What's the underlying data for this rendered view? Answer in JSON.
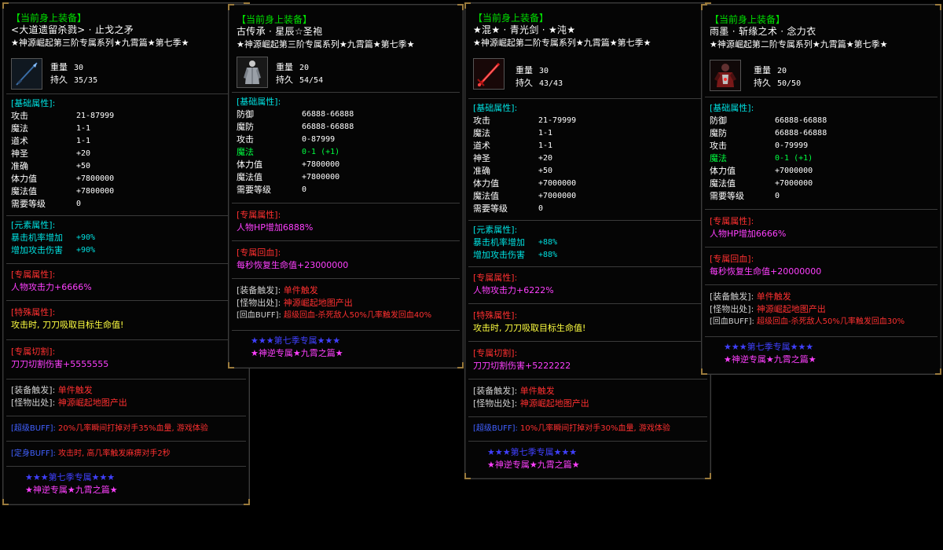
{
  "cards": [
    {
      "header": "【当前身上装备】",
      "name": "<大道遗留杀戮> · 止戈之矛",
      "series": "★神源崛起第三阶专属系列★九霄篇★第七季★",
      "icon": "spear-icon",
      "weight_label": "重量",
      "weight": "30",
      "durability_label": "持久",
      "durability": "35/35",
      "base_title": "[基础属性]:",
      "base": [
        {
          "k": "攻击",
          "v": "21-87999"
        },
        {
          "k": "魔法",
          "v": "1-1"
        },
        {
          "k": "道术",
          "v": "1-1"
        },
        {
          "k": "神圣",
          "v": "+20"
        },
        {
          "k": "准确",
          "v": "+50"
        },
        {
          "k": "体力值",
          "v": "+7800000"
        },
        {
          "k": "魔法值",
          "v": "+7800000"
        },
        {
          "k": "需要等级",
          "v": "0"
        }
      ],
      "element_title": "[元素属性]:",
      "element": [
        {
          "k": "暴击机率增加",
          "v": "+90%"
        },
        {
          "k": "增加攻击伤害",
          "v": "+90%"
        }
      ],
      "exclusive_title": "[专属属性]:",
      "exclusive": "人物攻击力+6666%",
      "special_title": "[特殊属性]:",
      "special": "攻击时, 刀刀吸取目标生命值!",
      "cut_title": "[专属切割]:",
      "cut": "刀刀切割伤害+5555555",
      "trigger_label": "[装备触发]:",
      "trigger": "单件触发",
      "drop_label": "[怪物出处]:",
      "drop": "神源崛起地图产出",
      "buff1_label": "[超级BUFF]:",
      "buff1": "20%几率瞬间打掉对手35%血量, 游戏体验",
      "buff2_label": "[定身BUFF]:",
      "buff2": "攻击时, 高几率触发麻痹对手2秒",
      "footer1": "★★★第七季专属★★★",
      "footer2": "★神逆专属★九霄之篇★"
    },
    {
      "header": "【当前身上装备】",
      "name": "古传承 · 星辰☆圣袍",
      "series": "★神源崛起第三阶专属系列★九霄篇★第七季★",
      "icon": "robe-icon",
      "weight_label": "重量",
      "weight": "20",
      "durability_label": "持久",
      "durability": "54/54",
      "base_title": "[基础属性]:",
      "base": [
        {
          "k": "防御",
          "v": "66888-66888"
        },
        {
          "k": "魔防",
          "v": "66888-66888"
        },
        {
          "k": "攻击",
          "v": "0-87999"
        },
        {
          "k": "魔法",
          "v": "0-1 (+1)",
          "green": true
        },
        {
          "k": "体力值",
          "v": "+7800000"
        },
        {
          "k": "魔法值",
          "v": "+7800000"
        },
        {
          "k": "需要等级",
          "v": "0"
        }
      ],
      "exclusive_title": "[专属属性]:",
      "exclusive": "人物HP增加6888%",
      "regen_title": "[专属回血]:",
      "regen": "每秒恢复生命值+23000000",
      "trigger_label": "[装备触发]:",
      "trigger": "单件触发",
      "drop_label": "[怪物出处]:",
      "drop": "神源崛起地图产出",
      "buff_label": "[回血BUFF]:",
      "buff": "超级回血-杀死敌人50%几率触发回血40%",
      "footer1": "★★★第七季专属★★★",
      "footer2": "★神逆专属★九霄之篇★"
    },
    {
      "header": "【当前身上装备】",
      "name": "★混★ · 青光剑 · ★沌★",
      "series": "★神源崛起第二阶专属系列★九霄篇★第七季★",
      "icon": "sword-icon",
      "weight_label": "重量",
      "weight": "30",
      "durability_label": "持久",
      "durability": "43/43",
      "base_title": "[基础属性]:",
      "base": [
        {
          "k": "攻击",
          "v": "21-79999"
        },
        {
          "k": "魔法",
          "v": "1-1"
        },
        {
          "k": "道术",
          "v": "1-1"
        },
        {
          "k": "神圣",
          "v": "+20"
        },
        {
          "k": "准确",
          "v": "+50"
        },
        {
          "k": "体力值",
          "v": "+7000000"
        },
        {
          "k": "魔法值",
          "v": "+7000000"
        },
        {
          "k": "需要等级",
          "v": "0"
        }
      ],
      "element_title": "[元素属性]:",
      "element": [
        {
          "k": "暴击机率增加",
          "v": "+88%"
        },
        {
          "k": "增加攻击伤害",
          "v": "+88%"
        }
      ],
      "exclusive_title": "[专属属性]:",
      "exclusive": "人物攻击力+6222%",
      "special_title": "[特殊属性]:",
      "special": "攻击时, 刀刀吸取目标生命值!",
      "cut_title": "[专属切割]:",
      "cut": "刀刀切割伤害+5222222",
      "trigger_label": "[装备触发]:",
      "trigger": "单件触发",
      "drop_label": "[怪物出处]:",
      "drop": "神源崛起地图产出",
      "buff1_label": "[超级BUFF]:",
      "buff1": "10%几率瞬间打掉对手30%血量, 游戏体验",
      "footer1": "★★★第七季专属★★★",
      "footer2": "★神逆专属★九霄之篇★"
    },
    {
      "header": "【当前身上装备】",
      "name": "雨墨 · 斩缘之术 · 念力衣",
      "series": "★神源崛起第二阶专属系列★九霄篇★第七季★",
      "icon": "armor-icon",
      "weight_label": "重量",
      "weight": "20",
      "durability_label": "持久",
      "durability": "50/50",
      "base_title": "[基础属性]:",
      "base": [
        {
          "k": "防御",
          "v": "66888-66888"
        },
        {
          "k": "魔防",
          "v": "66888-66888"
        },
        {
          "k": "攻击",
          "v": "0-79999"
        },
        {
          "k": "魔法",
          "v": "0-1 (+1)",
          "green": true
        },
        {
          "k": "体力值",
          "v": "+7000000"
        },
        {
          "k": "魔法值",
          "v": "+7000000"
        },
        {
          "k": "需要等级",
          "v": "0"
        }
      ],
      "exclusive_title": "[专属属性]:",
      "exclusive": "人物HP增加6666%",
      "regen_title": "[专属回血]:",
      "regen": "每秒恢复生命值+20000000",
      "trigger_label": "[装备触发]:",
      "trigger": "单件触发",
      "drop_label": "[怪物出处]:",
      "drop": "神源崛起地图产出",
      "buff_label": "[回血BUFF]:",
      "buff": "超级回血-杀死敌人50%几率触发回血30%",
      "footer1": "★★★第七季专属★★★",
      "footer2": "★神逆专属★九霄之篇★"
    }
  ]
}
